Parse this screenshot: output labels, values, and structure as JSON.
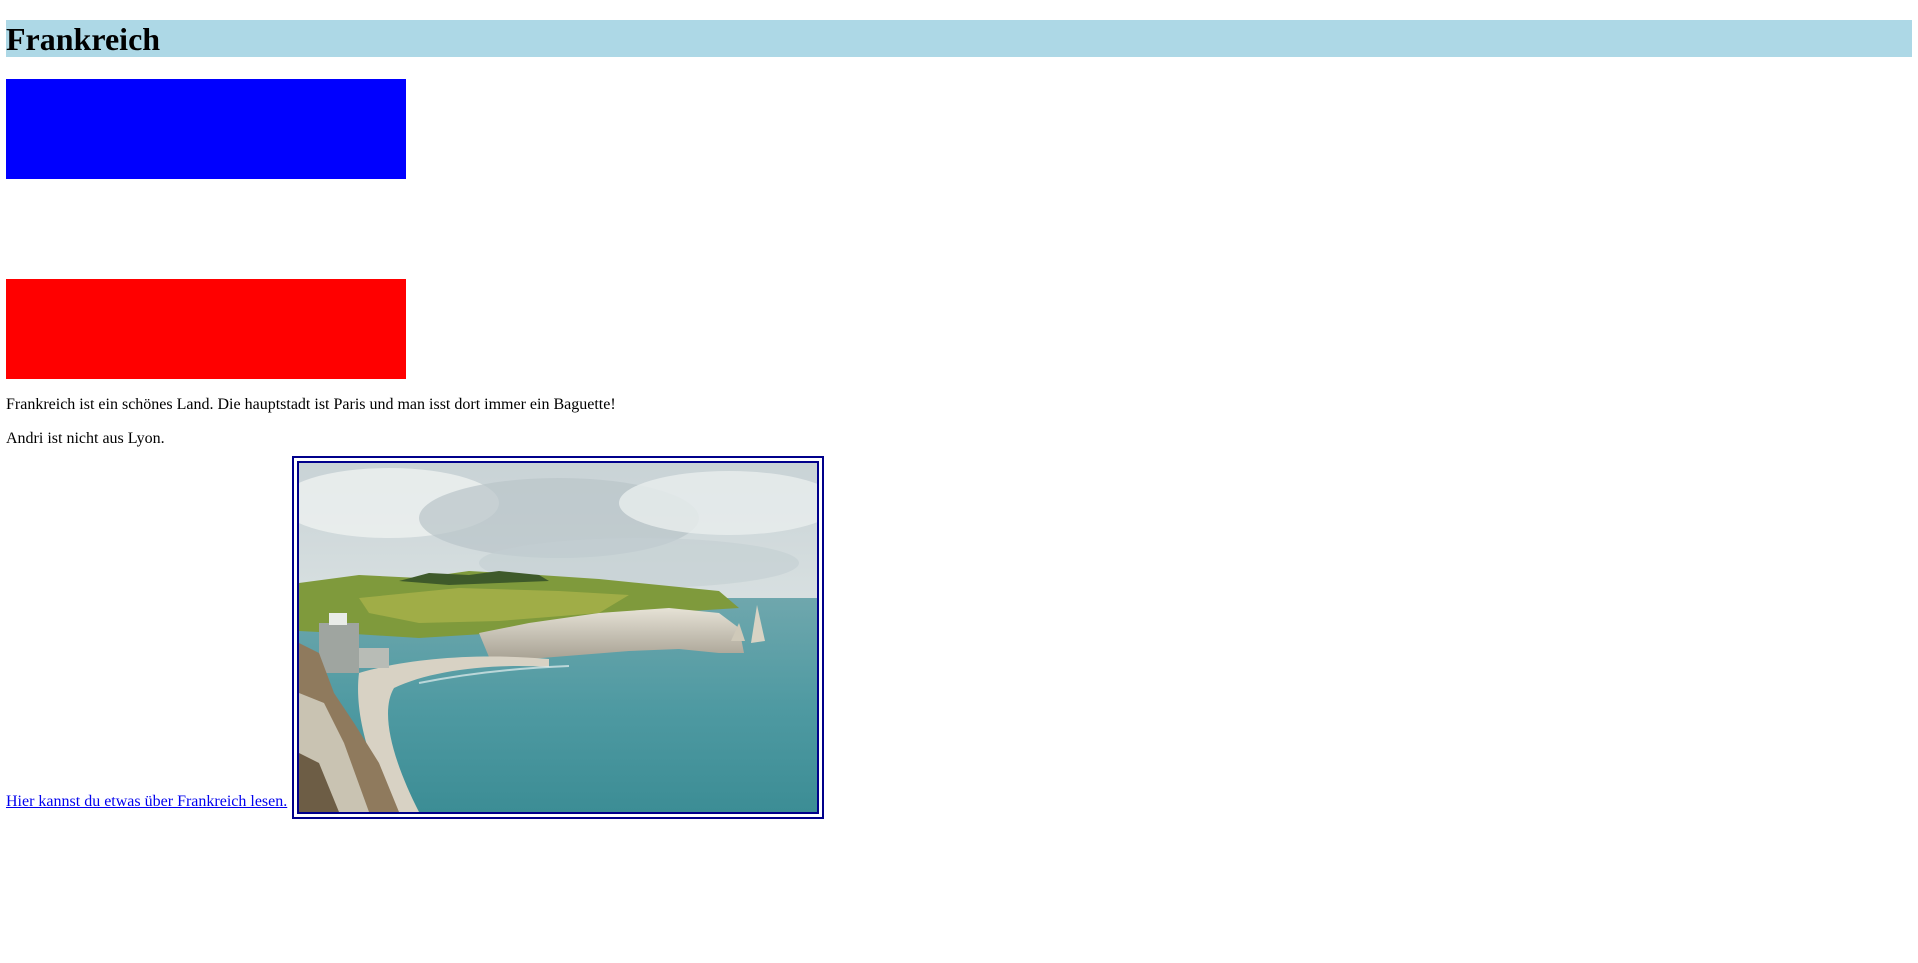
{
  "page": {
    "title": "Frankreich",
    "title_background": "#add8e6",
    "flag_blocks": [
      {
        "color": "#0000ff"
      },
      {
        "color": "#ff0000"
      }
    ],
    "paragraphs": [
      "Frankreich ist ein schönes Land. Die hauptstadt ist Paris und man isst dort immer ein Baguette!",
      "Andri ist nicht aus Lyon."
    ],
    "link": {
      "text": "Hier kannst du etwas über Frankreich lesen. ",
      "color": "#0000ee"
    },
    "image": {
      "subject": "coastal cliffs with sea arch and beach",
      "border_color": "#00008b"
    }
  }
}
